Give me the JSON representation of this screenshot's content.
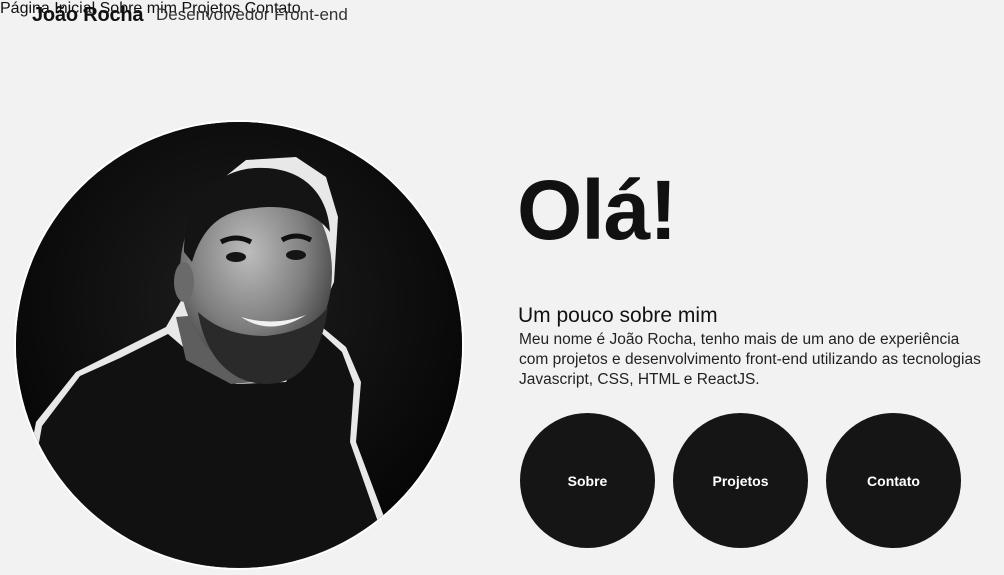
{
  "header": {
    "name": "João Rocha",
    "role": "Desenvolvedor Front-end",
    "nav": [
      {
        "label": "Página Inicial"
      },
      {
        "label": "Sobre mim"
      },
      {
        "label": "Projetos"
      },
      {
        "label": "Contato"
      }
    ]
  },
  "hero": {
    "greeting": "Olá!",
    "about_title": "Um pouco sobre mim",
    "about_text": "Meu nome é João Rocha, tenho mais de um ano de experiência com projetos e desenvolvimento front-end utilizando as tecnologias Javascript, CSS, HTML e ReactJS.",
    "buttons": [
      {
        "label": "Sobre"
      },
      {
        "label": "Projetos"
      },
      {
        "label": "Contato"
      }
    ]
  },
  "colors": {
    "background": "#f2f2f2",
    "button_bg": "#151515",
    "button_text": "#ffffff",
    "text_primary": "#111111"
  }
}
